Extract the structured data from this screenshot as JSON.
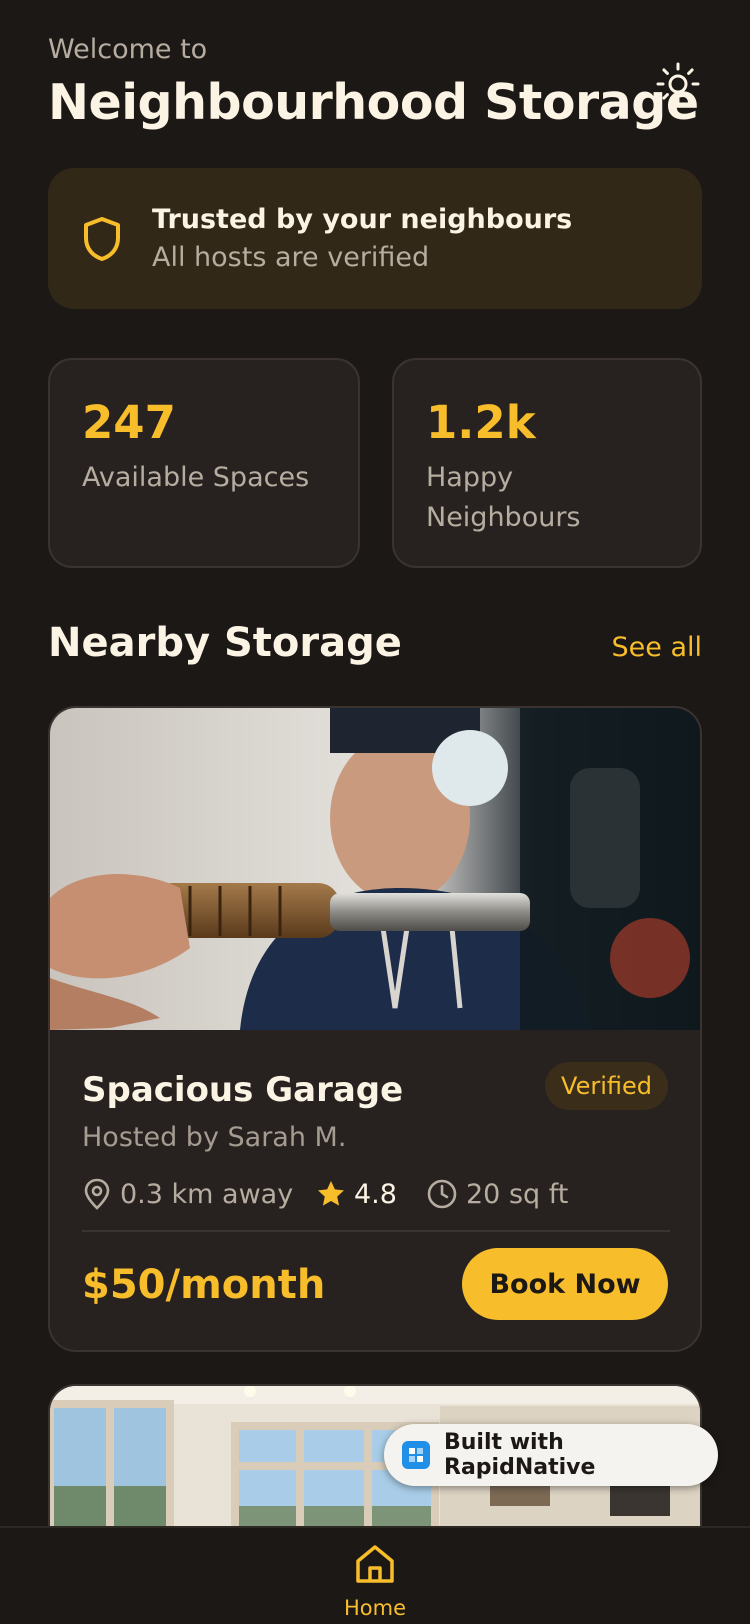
{
  "header": {
    "welcome": "Welcome to",
    "title": "Neighbourhood Storage",
    "theme_icon": "sun-icon"
  },
  "trust_banner": {
    "title": "Trusted by your neighbours",
    "subtitle": "All hosts are verified",
    "icon": "shield-icon"
  },
  "stats": [
    {
      "value": "247",
      "label": "Available Spaces"
    },
    {
      "value": "1.2k",
      "label": "Happy Neighbours"
    }
  ],
  "nearby": {
    "title": "Nearby Storage",
    "see_all": "See all"
  },
  "listings": [
    {
      "name": "Spacious Garage",
      "badge": "Verified",
      "host": "Hosted by Sarah M.",
      "distance": "0.3 km away",
      "rating": "4.8",
      "size": "20 sq ft",
      "price": "$50/month",
      "cta": "Book Now"
    }
  ],
  "built_badge": {
    "label": "Built with RapidNative"
  },
  "tabbar": {
    "home_label": "Home"
  },
  "colors": {
    "background": "#1c1816",
    "card": "#272220",
    "accent": "#f8bd2a",
    "text": "#fbf3e4",
    "muted": "#b6aca0"
  }
}
